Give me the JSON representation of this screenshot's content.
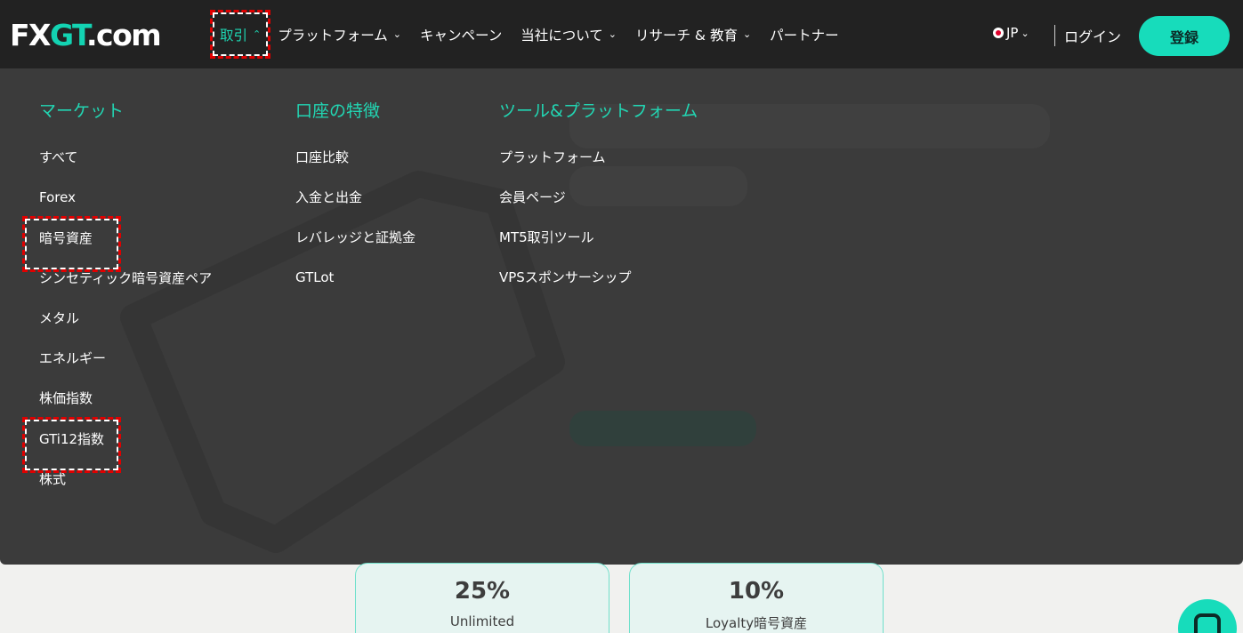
{
  "header": {
    "logo": {
      "fx": "FX",
      "g": "GT",
      "dom": ".com"
    },
    "nav": [
      {
        "label": "取引",
        "chevron": "up",
        "active": true
      },
      {
        "label": "プラットフォーム",
        "chevron": "down"
      },
      {
        "label": "キャンペーン"
      },
      {
        "label": "当社について",
        "chevron": "down"
      },
      {
        "label": "リサーチ & 教育",
        "chevron": "down"
      },
      {
        "label": "パートナー"
      }
    ],
    "lang": "JP",
    "login": "ログイン",
    "register": "登録"
  },
  "menu": {
    "market": {
      "title": "マーケット",
      "items": [
        "すべて",
        "Forex",
        "暗号資産",
        "シンセティック暗号資産ペア",
        "メタル",
        "エネルギー",
        "株価指数",
        "GTi12指数",
        "株式"
      ]
    },
    "account": {
      "title": "口座の特徴",
      "items": [
        "口座比較",
        "入金と出金",
        "レバレッジと証拠金",
        "GTLot"
      ]
    },
    "tools": {
      "title": "ツール&プラットフォーム",
      "items": [
        "プラットフォーム",
        "会員ページ",
        "MT5取引ツール",
        "VPSスポンサーシップ"
      ]
    }
  },
  "cards": [
    {
      "pct": "25%",
      "sub": "Unlimited"
    },
    {
      "pct": "10%",
      "sub": "Loyalty暗号資産"
    }
  ],
  "colors": {
    "accent": "#17dcbb",
    "menu_bg": "#3b3b3b",
    "topbar": "#222222"
  },
  "icons": {
    "chat": "chat-bubble-icon",
    "flag": "japan-flag-icon"
  }
}
